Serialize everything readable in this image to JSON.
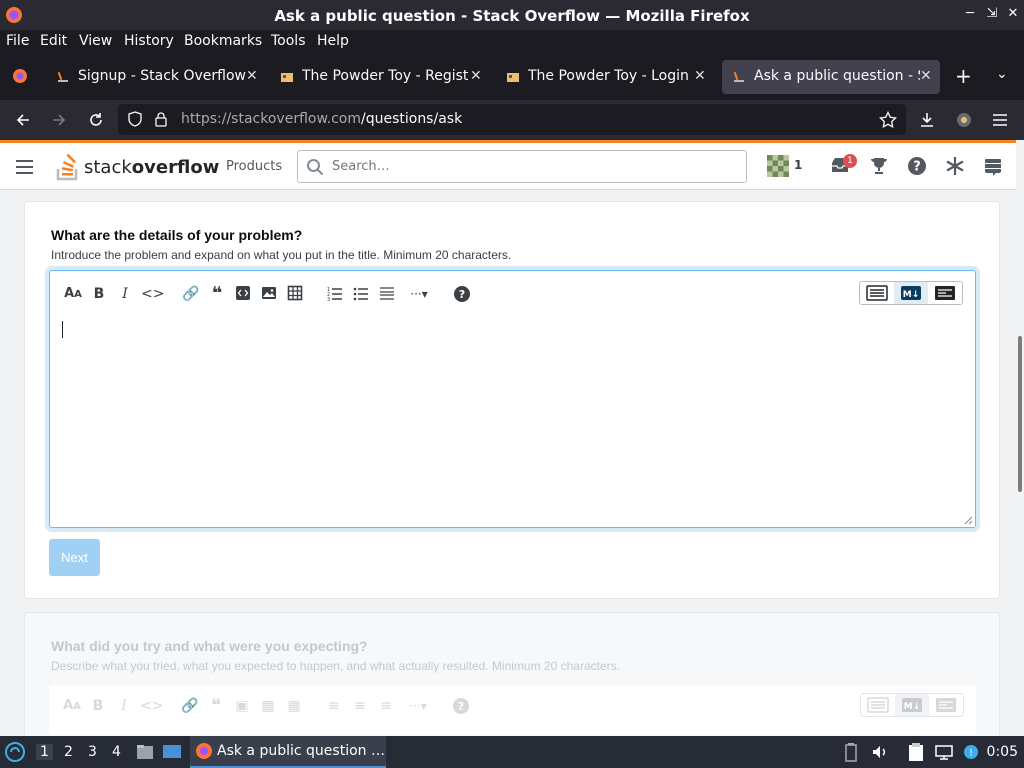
{
  "window": {
    "title": "Ask a public question - Stack Overflow — Mozilla Firefox"
  },
  "menu": [
    "File",
    "Edit",
    "View",
    "History",
    "Bookmarks",
    "Tools",
    "Help"
  ],
  "tabs": [
    {
      "label": "Signup - Stack Overflow",
      "active": false
    },
    {
      "label": "The Powder Toy - Registe",
      "active": false
    },
    {
      "label": "The Powder Toy - Login",
      "active": false
    },
    {
      "label": "Ask a public question - St",
      "active": true
    }
  ],
  "nav": {
    "url_host": "https://stackoverflow.com",
    "url_path": "/questions/ask"
  },
  "so": {
    "logo_stack": "stack",
    "logo_overflow": "overflow",
    "products": "Products",
    "search_placeholder": "Search…",
    "reputation": "1",
    "inbox_count": "1"
  },
  "section1": {
    "heading": "What are the details of your problem?",
    "hint": "Introduce the problem and expand on what you put in the title. Minimum 20 characters.",
    "next_label": "Next"
  },
  "section2": {
    "heading": "What did you try and what were you expecting?",
    "hint": "Describe what you tried, what you expected to happen, and what actually resulted. Minimum 20 characters."
  },
  "toolbar": {
    "items": [
      "text-size",
      "bold",
      "italic",
      "code",
      "link",
      "blockquote",
      "code-block",
      "image",
      "table",
      "ordered-list",
      "unordered-list",
      "horizontal-rule",
      "more",
      "help"
    ]
  },
  "taskbar": {
    "workspaces": [
      "1",
      "2",
      "3",
      "4"
    ],
    "app_label": "Ask a public question …",
    "clock": "0:05"
  },
  "colors": {
    "so_orange": "#f48225",
    "focus_blue": "#6bbbf7",
    "next_disabled": "#a0d1f5",
    "badge_red": "#de4f54"
  }
}
